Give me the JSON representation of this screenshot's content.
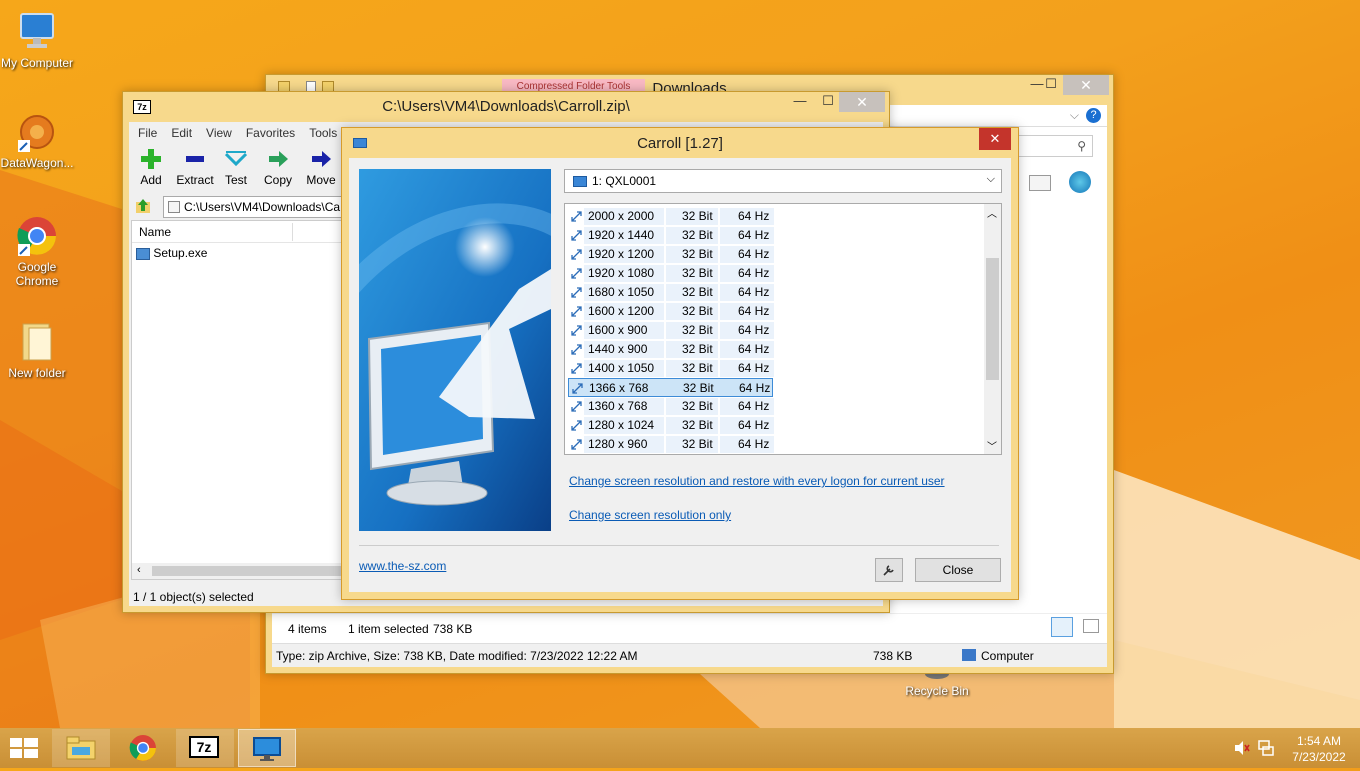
{
  "desktop": {
    "icons": [
      {
        "label": "My Computer"
      },
      {
        "label": "DataWagon..."
      },
      {
        "label": "Google Chrome"
      },
      {
        "label": "New folder"
      },
      {
        "label": "Recycle Bin"
      }
    ]
  },
  "explorer": {
    "ribbon_tab": "Compressed Folder Tools",
    "title": "Downloads",
    "status": {
      "items": "4 items",
      "selected": "1 item selected",
      "size": "738 KB"
    },
    "details": {
      "text": "Type: zip Archive, Size: 738 KB, Date modified: 7/23/2022 12:22 AM",
      "size": "738 KB",
      "location": "Computer"
    }
  },
  "sevenzip": {
    "logo": "7z",
    "title": "C:\\Users\\VM4\\Downloads\\Carroll.zip\\",
    "menu": [
      "File",
      "Edit",
      "View",
      "Favorites",
      "Tools"
    ],
    "toolbar": [
      {
        "label": "Add"
      },
      {
        "label": "Extract"
      },
      {
        "label": "Test"
      },
      {
        "label": "Copy"
      },
      {
        "label": "Move"
      }
    ],
    "path": "C:\\Users\\VM4\\Downloads\\Ca",
    "column_name": "Name",
    "file": "Setup.exe",
    "status": "1 / 1 object(s) selected"
  },
  "carroll": {
    "title": "Carroll [1.27]",
    "close_glyph": "✕",
    "display_select": "1: QXL0001",
    "resolutions": [
      {
        "res": "2000 x 2000",
        "bits": "32 Bit",
        "hz": "64 Hz"
      },
      {
        "res": "1920 x 1440",
        "bits": "32 Bit",
        "hz": "64 Hz"
      },
      {
        "res": "1920 x 1200",
        "bits": "32 Bit",
        "hz": "64 Hz"
      },
      {
        "res": "1920 x 1080",
        "bits": "32 Bit",
        "hz": "64 Hz"
      },
      {
        "res": "1680 x 1050",
        "bits": "32 Bit",
        "hz": "64 Hz"
      },
      {
        "res": "1600 x 1200",
        "bits": "32 Bit",
        "hz": "64 Hz"
      },
      {
        "res": "1600 x 900",
        "bits": "32 Bit",
        "hz": "64 Hz"
      },
      {
        "res": "1440 x 900",
        "bits": "32 Bit",
        "hz": "64 Hz"
      },
      {
        "res": "1400 x 1050",
        "bits": "32 Bit",
        "hz": "64 Hz"
      },
      {
        "res": "1366 x 768",
        "bits": "32 Bit",
        "hz": "64 Hz",
        "selected": true
      },
      {
        "res": "1360 x 768",
        "bits": "32 Bit",
        "hz": "64 Hz"
      },
      {
        "res": "1280 x 1024",
        "bits": "32 Bit",
        "hz": "64 Hz"
      },
      {
        "res": "1280 x 960",
        "bits": "32 Bit",
        "hz": "64 Hz"
      }
    ],
    "link_restore": "Change screen resolution and restore with every logon for current user",
    "link_only": "Change screen resolution only",
    "website": "www.the-sz.com",
    "close_button": "Close"
  },
  "taskbar": {
    "time": "1:54 AM",
    "date": "7/23/2022",
    "sevenzip_logo": "7z"
  },
  "colors": {
    "accent": "#f6a71a",
    "link": "#0a5bb5",
    "selection": "#cce4f7"
  }
}
